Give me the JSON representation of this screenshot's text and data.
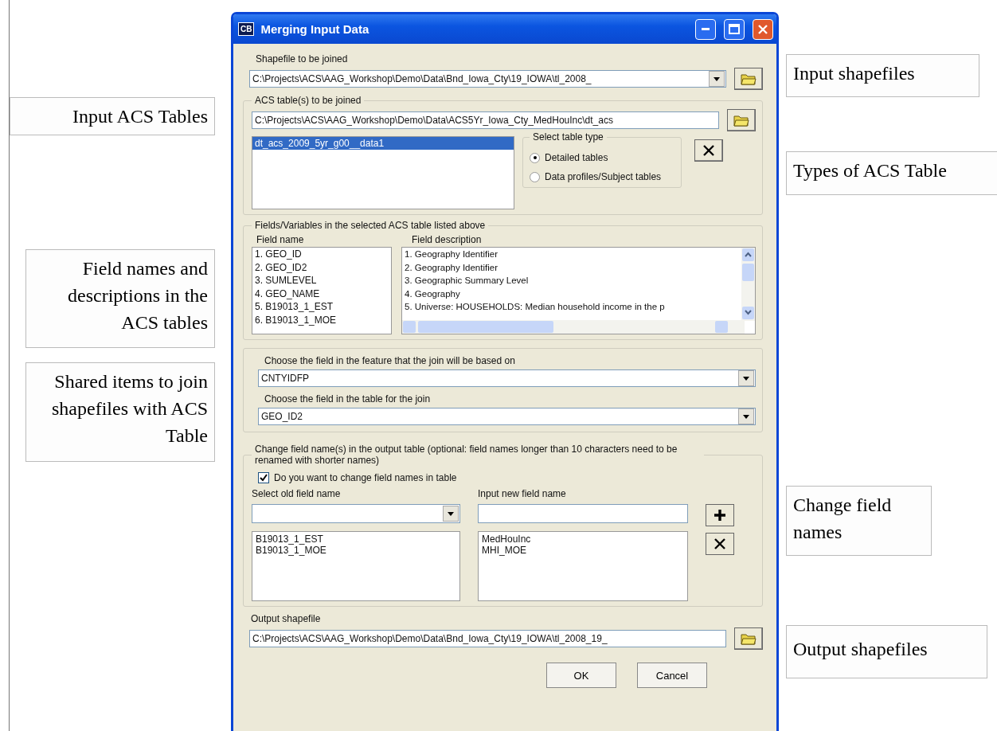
{
  "left_callouts": [
    "Input ACS Tables",
    "Field names and descriptions in the ACS tables",
    "Shared items to join shapefiles with ACS Table"
  ],
  "right_callouts": [
    "Input shapefiles",
    "Types of ACS Table",
    "Change field names",
    "Output shapefiles"
  ],
  "window": {
    "title": "Merging Input Data",
    "icon_text": "CB"
  },
  "shapefile": {
    "label": "Shapefile to be joined",
    "value": "C:\\Projects\\ACS\\AAG_Workshop\\Demo\\Data\\Bnd_Iowa_Cty\\19_IOWA\\tl_2008_"
  },
  "acs_group": {
    "title": "ACS table(s) to be joined",
    "path": "C:\\Projects\\ACS\\AAG_Workshop\\Demo\\Data\\ACS5Yr_Iowa_Cty_MedHouInc\\dt_acs",
    "tables": [
      {
        "label": "dt_acs_2009_5yr_g00__data1",
        "selected": true
      }
    ],
    "table_type": {
      "title": "Select table type",
      "options": [
        {
          "label": "Detailed tables",
          "selected": true
        },
        {
          "label": "Data profiles/Subject tables",
          "selected": false
        }
      ]
    }
  },
  "fields_group": {
    "title": "Fields/Variables in the selected ACS table listed above",
    "name_header": "Field name",
    "description_header": "Field description",
    "names": [
      "1. GEO_ID",
      "2. GEO_ID2",
      "3. SUMLEVEL",
      "4. GEO_NAME",
      "5. B19013_1_EST",
      "6. B19013_1_MOE"
    ],
    "descriptions": [
      "1. Geography Identifier",
      "2. Geography Identifier",
      "3. Geographic Summary Level",
      "4. Geography",
      "5. Universe:  HOUSEHOLDS: Median household income in the p"
    ]
  },
  "join": {
    "feature_label": "Choose the field in the feature that the join will be based on",
    "feature_value": "CNTYIDFP",
    "table_label": "Choose the field in the table for the join",
    "table_value": "GEO_ID2"
  },
  "rename": {
    "title": "Change field name(s) in the output table (optional: field names longer than 10 characters need to be renamed with shorter names)",
    "checkbox": {
      "label": "Do you want to change field names in table",
      "checked": true
    },
    "old_label": "Select old field name",
    "new_label": "Input new field name",
    "old_fields": [
      "B19013_1_EST",
      "B19013_1_MOE"
    ],
    "new_fields": [
      "MedHouInc",
      "MHI_MOE"
    ]
  },
  "output": {
    "label": "Output shapefile",
    "value": "C:\\Projects\\ACS\\AAG_Workshop\\Demo\\Data\\Bnd_Iowa_Cty\\19_IOWA\\tl_2008_19_"
  },
  "buttons": [
    "OK",
    "Cancel"
  ]
}
